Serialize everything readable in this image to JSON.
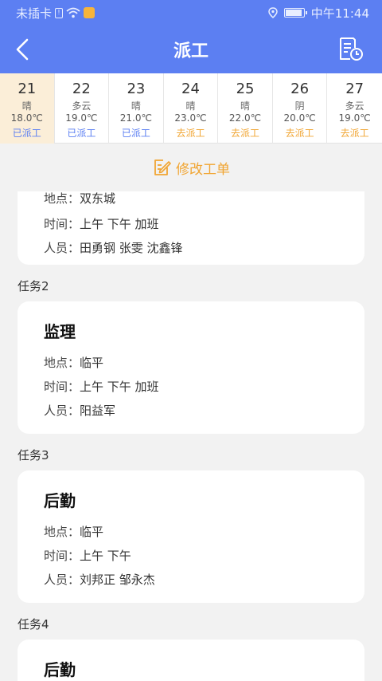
{
  "status_bar": {
    "carrier": "未插卡",
    "time": "中午11:44"
  },
  "nav": {
    "title": "派工"
  },
  "days": [
    {
      "day": "21",
      "weather": "晴",
      "temp": "18.0℃",
      "status": "已派工",
      "state": "done",
      "selected": true
    },
    {
      "day": "22",
      "weather": "多云",
      "temp": "19.0℃",
      "status": "已派工",
      "state": "done",
      "selected": false
    },
    {
      "day": "23",
      "weather": "晴",
      "temp": "21.0℃",
      "status": "已派工",
      "state": "done",
      "selected": false
    },
    {
      "day": "24",
      "weather": "晴",
      "temp": "23.0℃",
      "status": "去派工",
      "state": "todo",
      "selected": false
    },
    {
      "day": "25",
      "weather": "晴",
      "temp": "22.0℃",
      "status": "去派工",
      "state": "todo",
      "selected": false
    },
    {
      "day": "26",
      "weather": "阴",
      "temp": "20.0℃",
      "status": "去派工",
      "state": "todo",
      "selected": false
    },
    {
      "day": "27",
      "weather": "多云",
      "temp": "19.0℃",
      "status": "去派工",
      "state": "todo",
      "selected": false
    }
  ],
  "modify": {
    "label": "修改工单"
  },
  "labels": {
    "location": "地点：",
    "time": "时间：",
    "people": "人员："
  },
  "tasks": [
    {
      "label": "",
      "title": "",
      "location": "双东城",
      "time": "上午 下午 加班",
      "people": "田勇钢  张雯  沈鑫锋"
    },
    {
      "label": "任务2",
      "title": "监理",
      "location": "临平",
      "time": "上午 下午 加班",
      "people": "阳益军"
    },
    {
      "label": "任务3",
      "title": "后勤",
      "location": "临平",
      "time": "上午 下午",
      "people": "刘邦正  邹永杰"
    },
    {
      "label": "任务4",
      "title": "后勤",
      "location": "",
      "time": "",
      "people": ""
    }
  ],
  "colors": {
    "primary": "#5c7ff2",
    "accent": "#f1a532",
    "selected_day_bg": "#fbeed8"
  }
}
